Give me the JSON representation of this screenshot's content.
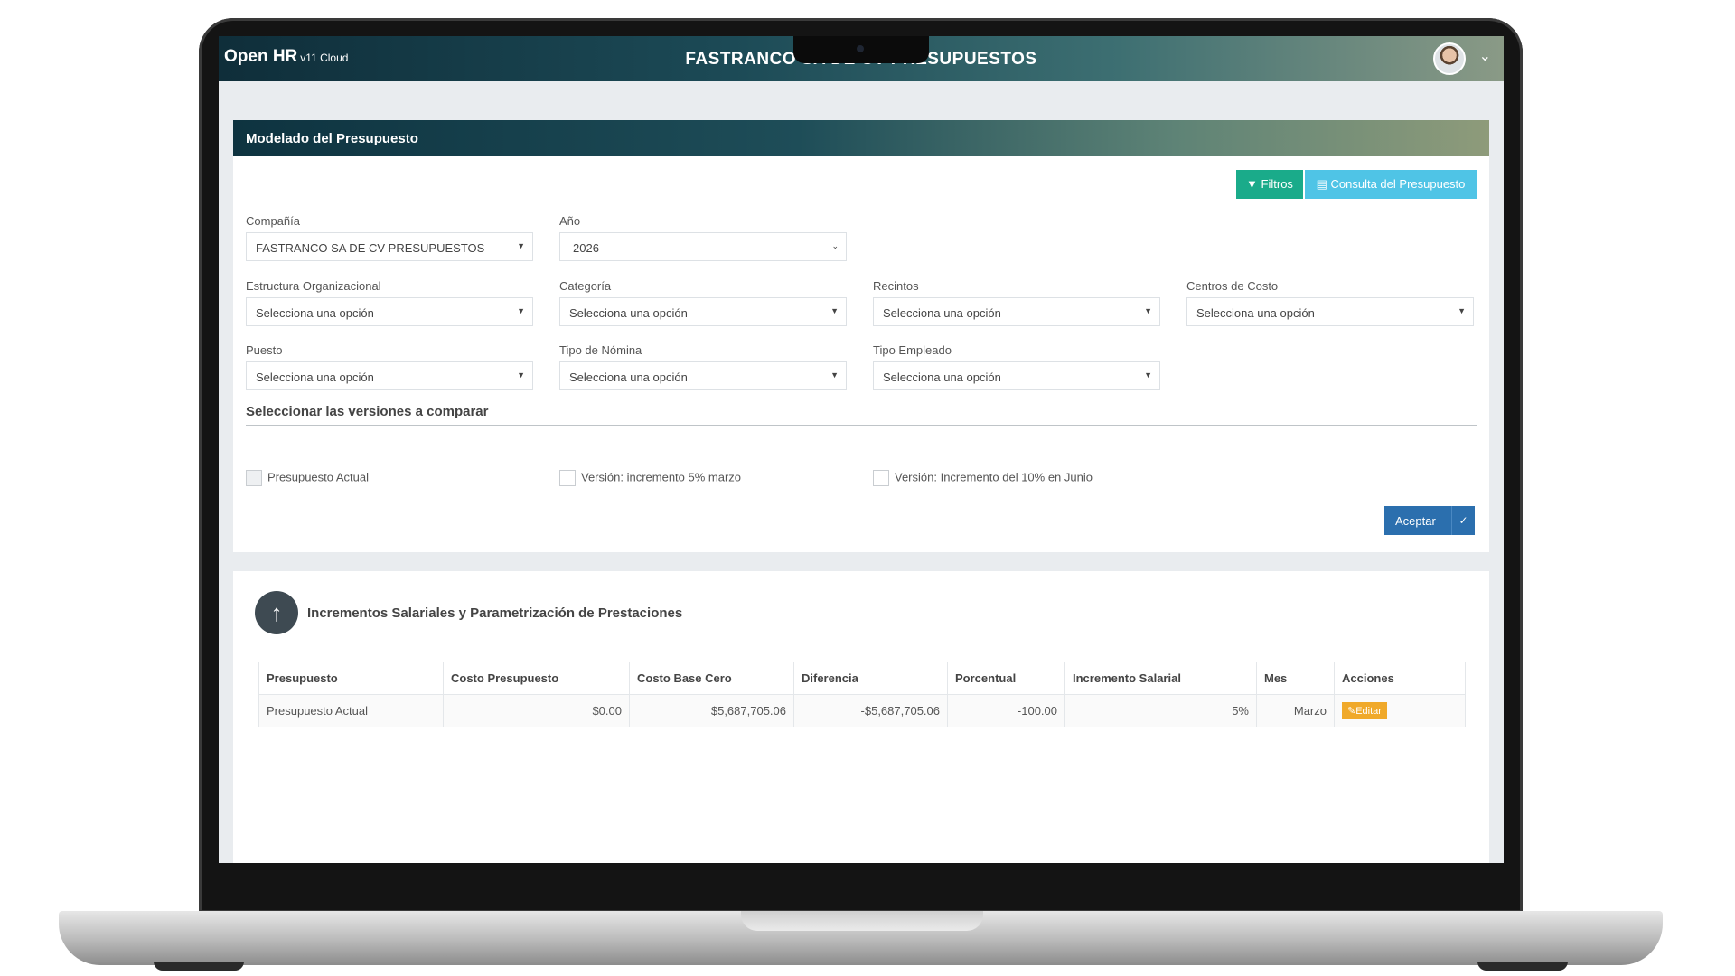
{
  "app": {
    "brand_main": "Open HR",
    "brand_sub": "v11 Cloud",
    "title": "FASTRANCO SA DE CV PRESUPUESTOS"
  },
  "panel1": {
    "title": "Modelado del Presupuesto",
    "filtros_label": "Filtros",
    "consulta_label": "Consulta del Presupuesto",
    "fields": {
      "compania": {
        "label": "Compañía",
        "value": "FASTRANCO SA DE CV PRESUPUESTOS"
      },
      "anio": {
        "label": "Año",
        "value": "2026"
      },
      "estructura": {
        "label": "Estructura Organizacional",
        "value": "Selecciona una opción"
      },
      "categoria": {
        "label": "Categoría",
        "value": "Selecciona una opción"
      },
      "recintos": {
        "label": "Recintos",
        "value": "Selecciona una opción"
      },
      "centros": {
        "label": "Centros de Costo",
        "value": "Selecciona una opción"
      },
      "puesto": {
        "label": "Puesto",
        "value": "Selecciona una opción"
      },
      "tipo_nomina": {
        "label": "Tipo de Nómina",
        "value": "Selecciona una opción"
      },
      "tipo_empleado": {
        "label": "Tipo Empleado",
        "value": "Selecciona una opción"
      }
    },
    "versions_title": "Seleccionar las versiones a comparar",
    "versions": [
      {
        "label": "Presupuesto Actual",
        "checked": false,
        "disabled": true
      },
      {
        "label": "Versión: incremento 5% marzo",
        "checked": false,
        "disabled": false
      },
      {
        "label": "Versión: Incremento del 10% en Junio",
        "checked": false,
        "disabled": false
      }
    ],
    "aceptar_label": "Aceptar"
  },
  "panel2": {
    "title": "Incrementos Salariales y Parametrización de Prestaciones",
    "columns": [
      "Presupuesto",
      "Costo Presupuesto",
      "Costo Base Cero",
      "Diferencia",
      "Porcentual",
      "Incremento Salarial",
      "Mes",
      "Acciones"
    ],
    "rows": [
      {
        "presupuesto": "Presupuesto Actual",
        "costo_presupuesto": "$0.00",
        "costo_base_cero": "$5,687,705.06",
        "diferencia": "-$5,687,705.06",
        "porcentual": "-100.00",
        "incremento_salarial": "5%",
        "mes": "Marzo",
        "accion_label": "Editar"
      }
    ]
  },
  "colors": {
    "header_dark": "#0f2e3a",
    "filtros": "#1aab8a",
    "consulta": "#4fc4e6",
    "aceptar": "#2b6fae",
    "editar": "#f0a92a"
  }
}
